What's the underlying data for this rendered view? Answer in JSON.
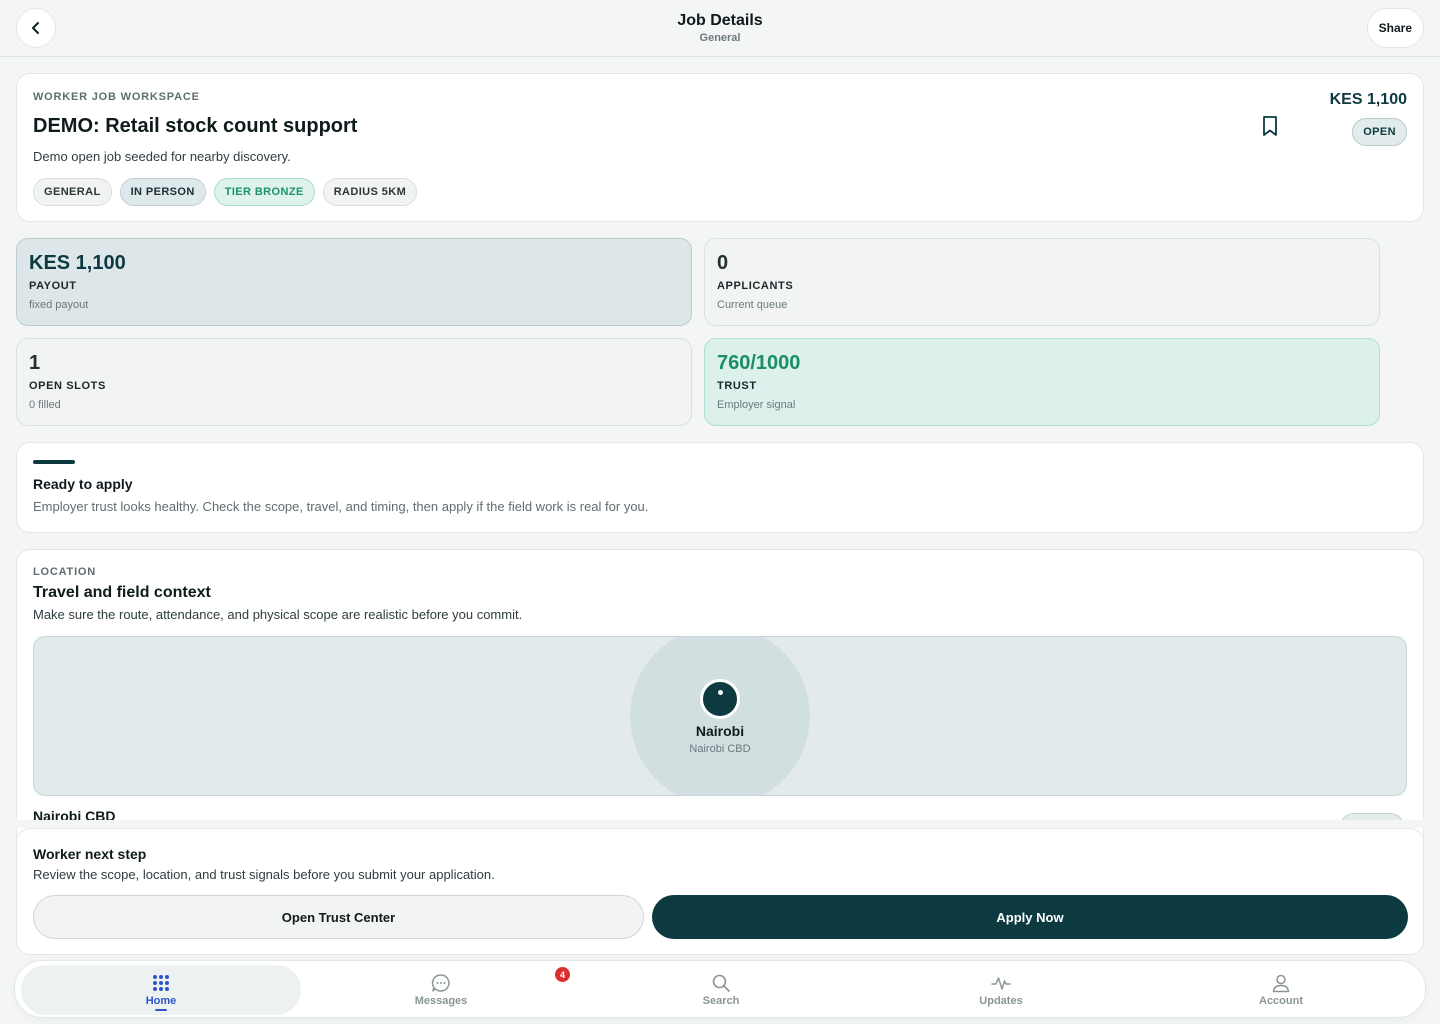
{
  "header": {
    "title": "Job Details",
    "subtitle": "General",
    "share_label": "Share"
  },
  "job": {
    "eyebrow": "WORKER JOB WORKSPACE",
    "title": "DEMO: Retail stock count support",
    "description": "Demo open job seeded for nearby discovery.",
    "price": "KES 1,100",
    "status": "OPEN",
    "chips": [
      "GENERAL",
      "IN PERSON",
      "TIER BRONZE",
      "RADIUS 5KM"
    ]
  },
  "stats": {
    "payout": {
      "value": "KES 1,100",
      "label": "PAYOUT",
      "sub": "fixed payout"
    },
    "applicants": {
      "value": "0",
      "label": "APPLICANTS",
      "sub": "Current queue"
    },
    "slots": {
      "value": "1",
      "label": "OPEN SLOTS",
      "sub": "0 filled"
    },
    "trust": {
      "value": "760/1000",
      "label": "TRUST",
      "sub": "Employer signal"
    }
  },
  "ready": {
    "title": "Ready to apply",
    "description": "Employer trust looks healthy. Check the scope, travel, and timing, then apply if the field work is real for you."
  },
  "location": {
    "eyebrow": "LOCATION",
    "title": "Travel and field context",
    "description": "Make sure the route, attendance, and physical scope are realistic before you commit.",
    "city": "Nairobi",
    "area": "Nairobi CBD",
    "line": "Nairobi CBD"
  },
  "next_step": {
    "title": "Worker next step",
    "description": "Review the scope, location, and trust signals before you submit your application.",
    "secondary_label": "Open Trust Center",
    "primary_label": "Apply Now"
  },
  "nav": {
    "items": [
      {
        "label": "Home",
        "icon": "grid-icon",
        "active": true
      },
      {
        "label": "Messages",
        "icon": "chat-icon",
        "badge": "4"
      },
      {
        "label": "Search",
        "icon": "search-icon"
      },
      {
        "label": "Updates",
        "icon": "pulse-icon"
      },
      {
        "label": "Account",
        "icon": "user-icon"
      }
    ]
  },
  "colors": {
    "brand": "#0d3a41",
    "trust_green": "#1a8f66",
    "active_nav": "#2d55c8",
    "badge_red": "#d92f2f"
  }
}
